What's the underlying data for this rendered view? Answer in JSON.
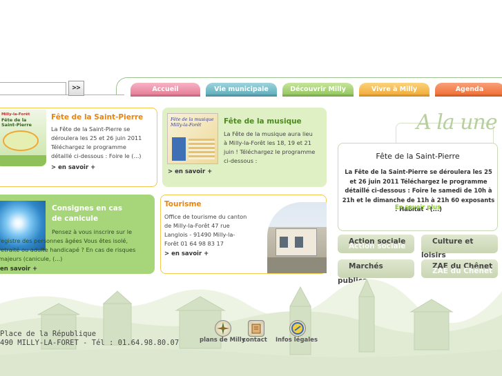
{
  "search": {
    "button_label": ">>"
  },
  "nav": {
    "tabs": [
      {
        "label": "Accueil"
      },
      {
        "label": "Vie municipale"
      },
      {
        "label": "Découvrir Milly"
      },
      {
        "label": "Vivre à Milly"
      },
      {
        "label": "Agenda"
      }
    ]
  },
  "cards": {
    "saint_pierre": {
      "title": "Fête de la Saint-Pierre",
      "text": "La Fête de la Saint-Pierre se déroulera les 25 et 26 juin 2011 Téléchargez le programme détaillé ci-dessous : Foire le (...)",
      "more": "> en savoir",
      "img_caption_1": "Milly-la-Forêt",
      "img_caption_2": "Fête de la Saint-Pierre"
    },
    "musique": {
      "title": "Fête de la musique",
      "text": "La Fête de la musique aura lieu à Milly-la-Forêt les 18, 19 et 21 juin ! Téléchargez le programme ci-dessous :",
      "more": "> en savoir",
      "poster_text": "Fête de la musique Milly-la-Forêt"
    },
    "canicule": {
      "title": "Consignes en cas de canicule",
      "text": "Pensez à vous inscrire sur le registre des personnes âgées Vous êtes isolé, retraité ou adulte handicapé ? En cas de risques majeurs (canicule, (...)",
      "more": "en savoir"
    },
    "tourisme": {
      "title": "Tourisme",
      "text": "Office de tourisme du canton de Milly-la-Forêt 47 rue Langlois - 91490 Milly-la-Forêt 01 64 98 83 17",
      "more": "> en savoir"
    }
  },
  "a_la_une": {
    "heading": "A la une",
    "title": "Fête de la Saint-Pierre",
    "text": "La Fête de la Saint-Pierre se déroulera les 25 et 26 juin 2011 Téléchargez le programme détaillé ci-dessous : Foire le samedi de 10h à 21h et le dimanche de 11h à 21h 60 exposants : Habitat - (...)",
    "more": "En savoir plus",
    "buttons": [
      {
        "label": "Action sociale",
        "shadow": "Action sociale"
      },
      {
        "label": "Culture et",
        "overflow": "loisirs"
      },
      {
        "label": "Marchés",
        "overflow": "publics"
      },
      {
        "label": "ZAE du Chênet",
        "shadow": "ZAE du Chênet"
      }
    ]
  },
  "footer": {
    "address_line1": "Place de la République",
    "address_line2": "490 MILLY-LA-FORET - Tél : 01.64.98.80.07",
    "links": [
      {
        "label": "plans de Milly",
        "icon": "compass-icon"
      },
      {
        "label": "contact",
        "icon": "letter-icon"
      },
      {
        "label": "Infos légales",
        "icon": "info-icon"
      }
    ]
  },
  "colors": {
    "accueil": "#e4768f",
    "vie_municipale": "#58a9b7",
    "decouvrir": "#8ec259",
    "vivre": "#f0a732",
    "agenda": "#ee6a2e",
    "card_title_orange": "#e8840f",
    "card_title_green": "#4c8a1e",
    "link_green": "#8cc63f"
  }
}
